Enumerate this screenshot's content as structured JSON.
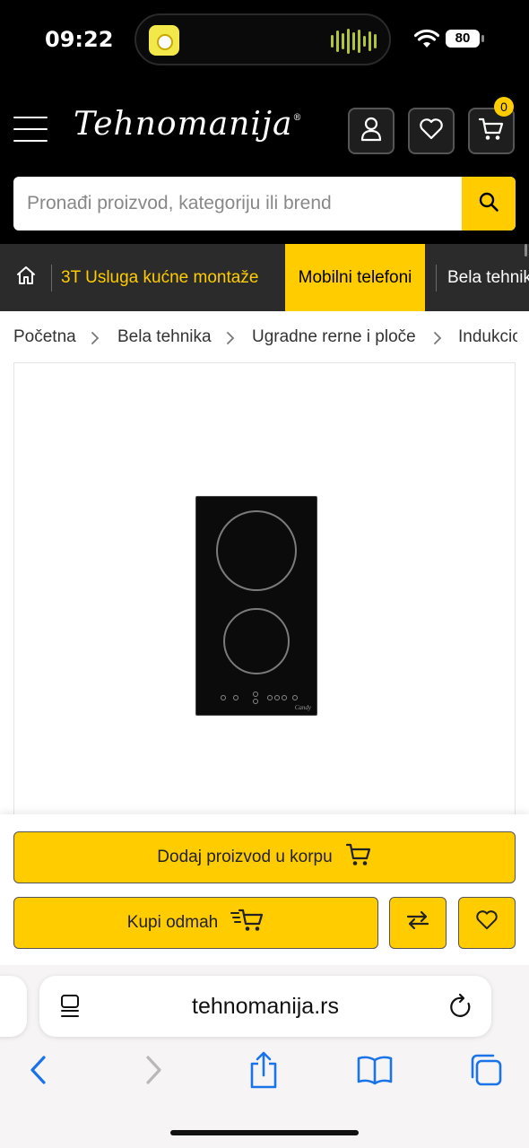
{
  "status_bar": {
    "time": "09:22",
    "battery": "80"
  },
  "header": {
    "logo": "Tehnomanija",
    "logo_mark": "®",
    "cart_count": "0",
    "search_placeholder": "Pronađi proizvod, kategoriju ili brend"
  },
  "nav": {
    "items": [
      {
        "label": "3T Usluga kućne montaže"
      },
      {
        "label": "Mobilni telefoni"
      },
      {
        "label": "Bela tehnika"
      }
    ]
  },
  "breadcrumb": [
    "Početna",
    "Bela tehnika",
    "Ugradne rerne i ploče",
    "Indukcio"
  ],
  "product": {
    "brand_mark": "Candy"
  },
  "actions": {
    "add_to_cart": "Dodaj proizvod u korpu",
    "buy_now": "Kupi odmah"
  },
  "browser": {
    "url": "tehnomanija.rs"
  },
  "colors": {
    "accent": "#ffcc00",
    "header_bg": "#000000",
    "nav_bg": "#2b2b2b",
    "safari_blue": "#1a73e8"
  }
}
